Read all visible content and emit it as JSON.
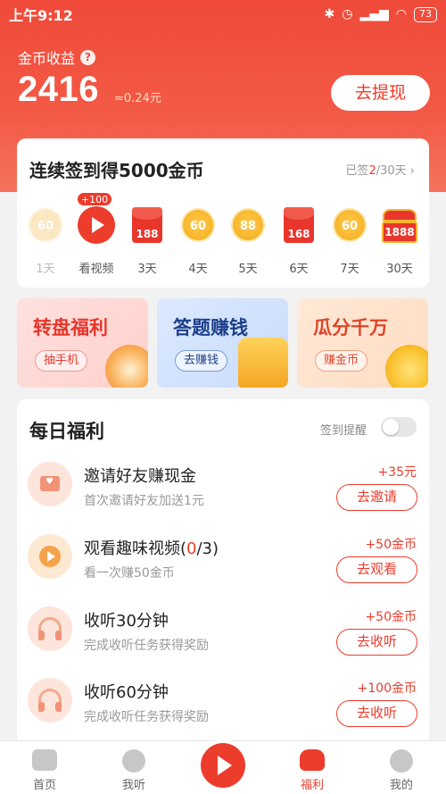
{
  "status_bar": {
    "time": "上午9:12",
    "battery": "73"
  },
  "header": {
    "coin_label": "金币收益",
    "coin_amount": "2416",
    "approx": "≈0.24元",
    "withdraw_label": "去提现"
  },
  "checkin": {
    "title": "连续签到得5000金币",
    "status_prefix": "已签",
    "status_count": "2",
    "status_suffix": "/30天",
    "days": [
      {
        "reward": "60",
        "label": "1天",
        "kind": "coin-dim"
      },
      {
        "reward": "+100",
        "label": "看视频",
        "kind": "video"
      },
      {
        "reward": "188",
        "label": "3天",
        "kind": "redpack"
      },
      {
        "reward": "60",
        "label": "4天",
        "kind": "coin"
      },
      {
        "reward": "88",
        "label": "5天",
        "kind": "coin"
      },
      {
        "reward": "168",
        "label": "6天",
        "kind": "redpack"
      },
      {
        "reward": "60",
        "label": "7天",
        "kind": "coin"
      },
      {
        "reward": "1888",
        "label": "30天",
        "kind": "chest"
      }
    ]
  },
  "promos": [
    {
      "title": "转盘福利",
      "button": "抽手机"
    },
    {
      "title": "答题赚钱",
      "button": "去赚钱"
    },
    {
      "title": "瓜分千万",
      "button": "赚金币"
    }
  ],
  "daily": {
    "title": "每日福利",
    "remind_label": "签到提醒",
    "tasks": [
      {
        "name": "邀请好友赚现金",
        "desc": "首次邀请好友加送1元",
        "reward": "+35元",
        "button": "去邀请"
      },
      {
        "name_prefix": "观看趣味视频(",
        "name_count": "0",
        "name_suffix": "/3)",
        "desc": "看一次赚50金币",
        "reward": "+50金币",
        "button": "去观看"
      },
      {
        "name": "收听30分钟",
        "desc": "完成收听任务获得奖励",
        "reward": "+50金币",
        "button": "去收听"
      },
      {
        "name": "收听60分钟",
        "desc": "完成收听任务获得奖励",
        "reward": "+100金币",
        "button": "去收听"
      }
    ]
  },
  "tabbar": [
    {
      "label": "首页"
    },
    {
      "label": "我听"
    },
    {
      "label": "福利"
    },
    {
      "label": "我的"
    }
  ]
}
